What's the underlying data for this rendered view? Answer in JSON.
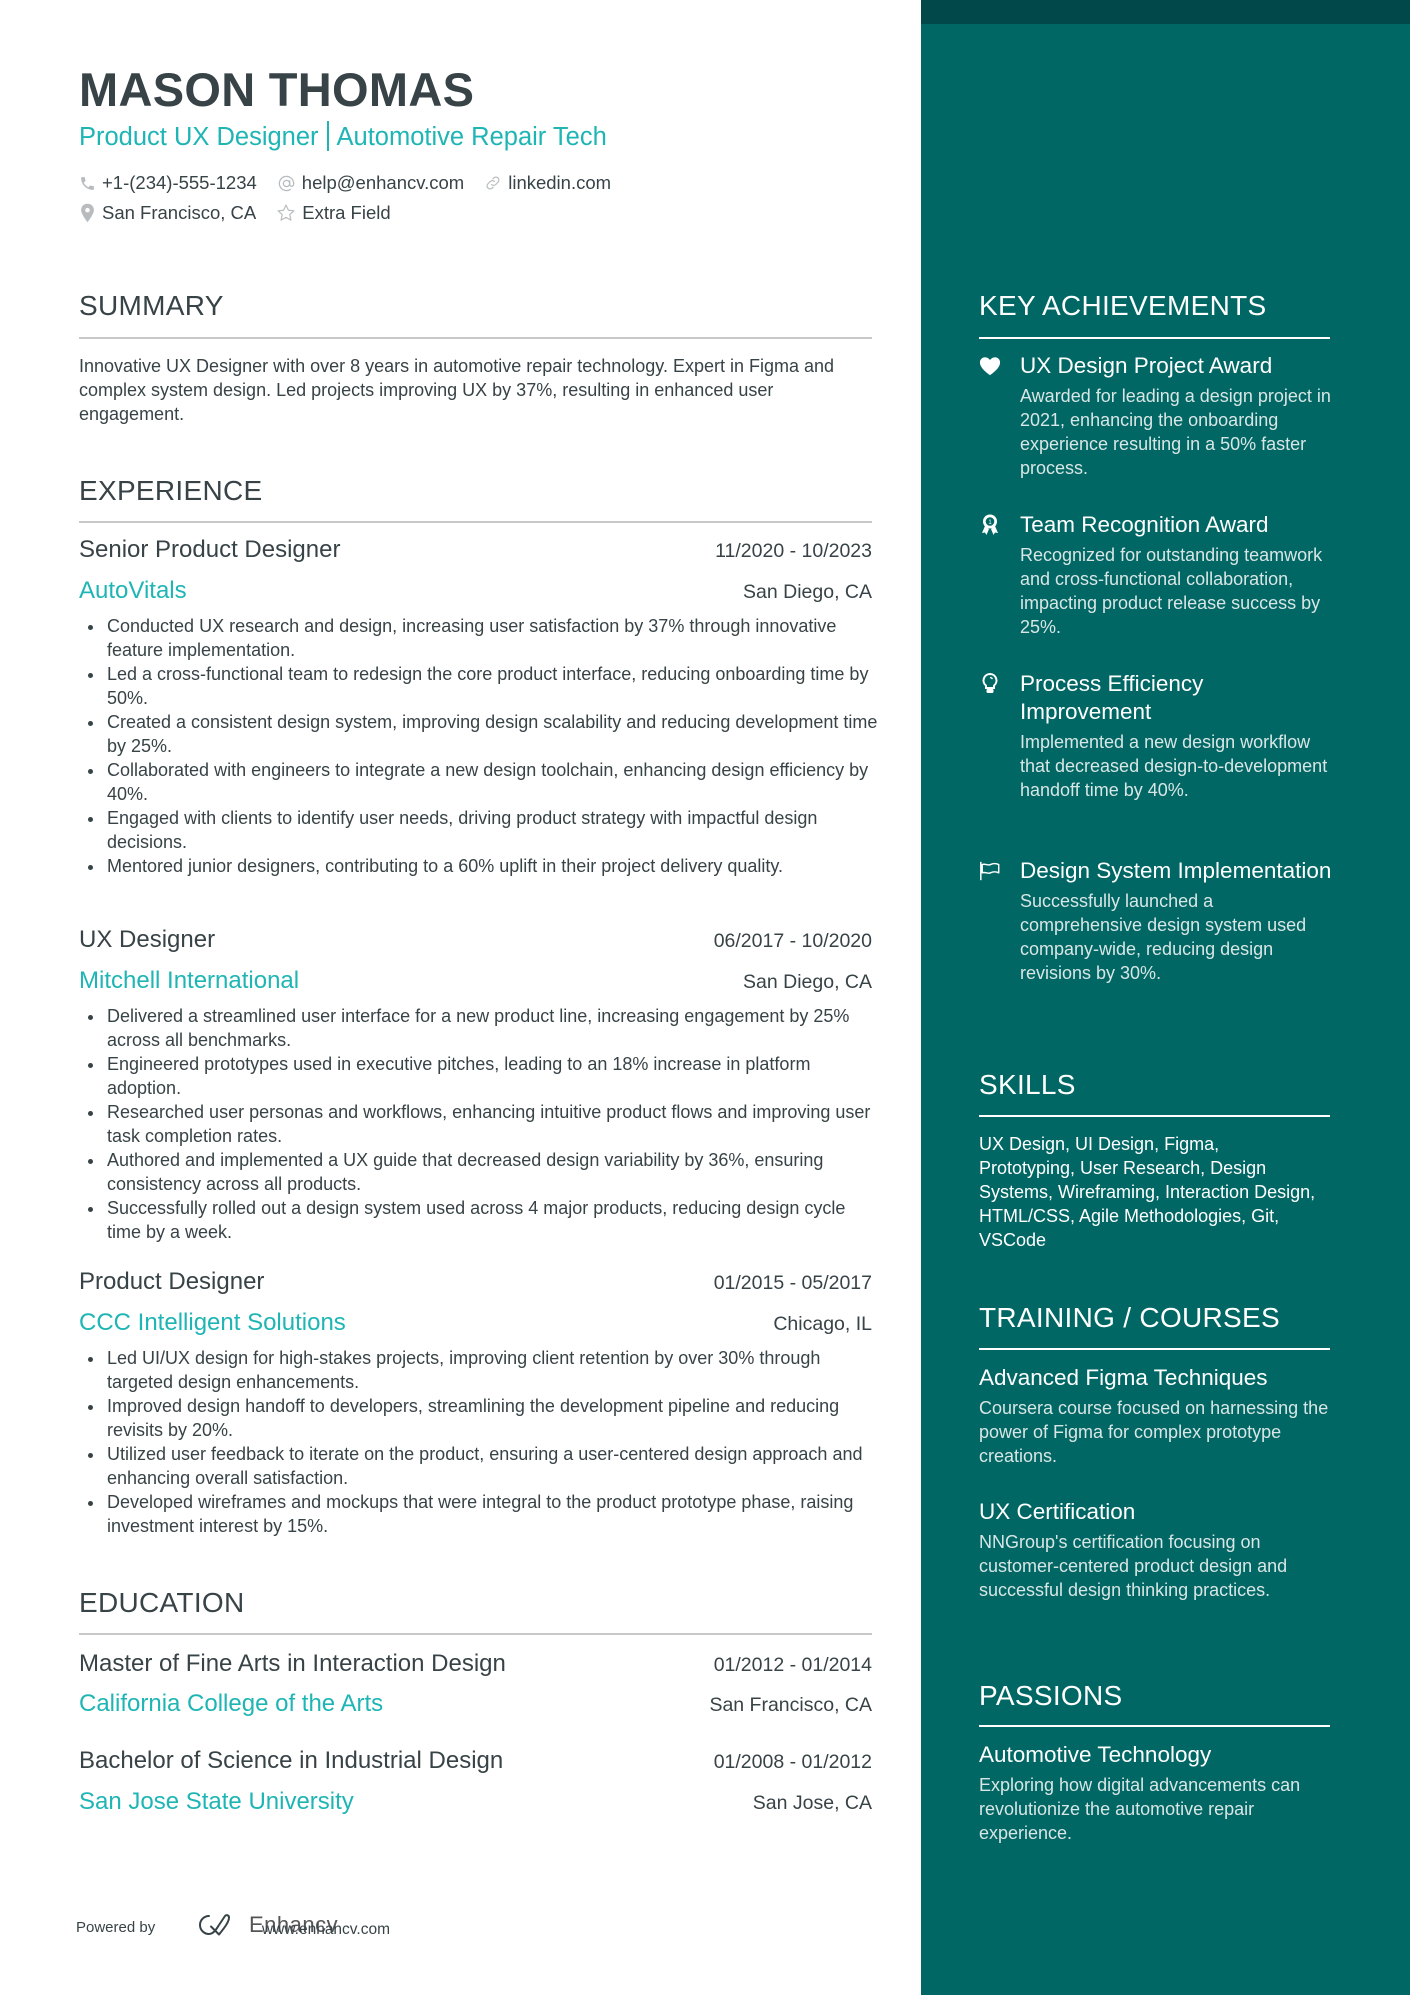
{
  "header": {
    "name": "MASON THOMAS",
    "title_left": "Product UX Designer",
    "title_right": "Automotive Repair Tech",
    "contacts": [
      {
        "icon": "phone-icon",
        "text": "+1-(234)-555-1234"
      },
      {
        "icon": "at-icon",
        "text": "help@enhancv.com"
      },
      {
        "icon": "link-icon",
        "text": "linkedin.com"
      },
      {
        "icon": "location-pin-icon",
        "text": "San Francisco, CA"
      },
      {
        "icon": "star-icon",
        "text": "Extra Field"
      }
    ]
  },
  "summary": {
    "heading": "SUMMARY",
    "text": "Innovative UX Designer with over 8 years in automotive repair technology. Expert in Figma and complex system design. Led projects improving UX by 37%, resulting in enhanced user engagement."
  },
  "experience": {
    "heading": "EXPERIENCE",
    "jobs": [
      {
        "role": "Senior Product Designer",
        "dates": "11/2020 - 10/2023",
        "company": "AutoVitals",
        "location": "San Diego, CA",
        "bullets": [
          "Conducted UX research and design, increasing user satisfaction by 37% through innovative feature implementation.",
          "Led a cross-functional team to redesign the core product interface, reducing onboarding time by 50%.",
          "Created a consistent design system, improving design scalability and reducing development time by 25%.",
          "Collaborated with engineers to integrate a new design toolchain, enhancing design efficiency by 40%.",
          "Engaged with clients to identify user needs, driving product strategy with impactful design decisions.",
          "Mentored junior designers, contributing to a 60% uplift in their project delivery quality."
        ]
      },
      {
        "role": "UX Designer",
        "dates": "06/2017 - 10/2020",
        "company": "Mitchell International",
        "location": "San Diego, CA",
        "bullets": [
          "Delivered a streamlined user interface for a new product line, increasing engagement by 25% across all benchmarks.",
          "Engineered prototypes used in executive pitches, leading to an 18% increase in platform adoption.",
          "Researched user personas and workflows, enhancing intuitive product flows and improving user task completion rates.",
          "Authored and implemented a UX guide that decreased design variability by 36%, ensuring consistency across all products.",
          "Successfully rolled out a design system used across 4 major products, reducing design cycle time by a week."
        ]
      },
      {
        "role": "Product Designer",
        "dates": "01/2015 - 05/2017",
        "company": "CCC Intelligent Solutions",
        "location": "Chicago, IL",
        "bullets": [
          "Led UI/UX design for high-stakes projects, improving client retention by over 30% through targeted design enhancements.",
          "Improved design handoff to developers, streamlining the development pipeline and reducing revisits by 20%.",
          "Utilized user feedback to iterate on the product, ensuring a user-centered design approach and enhancing overall satisfaction.",
          "Developed wireframes and mockups that were integral to the product prototype phase, raising investment interest by 15%."
        ]
      }
    ]
  },
  "education": {
    "heading": "EDUCATION",
    "items": [
      {
        "degree": "Master of Fine Arts in Interaction Design",
        "dates": "01/2012 - 01/2014",
        "school": "California College of the Arts",
        "location": "San Francisco, CA"
      },
      {
        "degree": "Bachelor of Science in Industrial Design",
        "dates": "01/2008 - 01/2012",
        "school": "San Jose State University",
        "location": "San Jose, CA"
      }
    ]
  },
  "achievements": {
    "heading": "KEY ACHIEVEMENTS",
    "items": [
      {
        "icon": "heart-icon",
        "title": "UX Design Project Award",
        "desc": "Awarded for leading a design project in 2021, enhancing the onboarding experience resulting in a 50% faster process."
      },
      {
        "icon": "award-ribbon-icon",
        "title": "Team Recognition Award",
        "desc": "Recognized for outstanding teamwork and cross-functional collaboration, impacting product release success by 25%."
      },
      {
        "icon": "lightbulb-icon",
        "title": "Process Efficiency Improvement",
        "desc": "Implemented a new design workflow that decreased design-to-development handoff time by 40%."
      },
      {
        "icon": "flag-icon",
        "title": "Design System Implementation",
        "desc": "Successfully launched a comprehensive design system used company-wide, reducing design revisions by 30%."
      }
    ]
  },
  "skills": {
    "heading": "SKILLS",
    "text": "UX Design, UI Design, Figma, Prototyping, User Research, Design Systems, Wireframing, Interaction Design, HTML/CSS, Agile Methodologies, Git, VSCode"
  },
  "training": {
    "heading": "TRAINING / COURSES",
    "items": [
      {
        "title": "Advanced Figma Techniques",
        "desc": "Coursera course focused on harnessing the power of Figma for complex prototype creations."
      },
      {
        "title": "UX Certification",
        "desc": "NNGroup's certification focusing on customer-centered product design and successful design thinking practices."
      }
    ]
  },
  "passions": {
    "heading": "PASSIONS",
    "items": [
      {
        "title": "Automotive Technology",
        "desc": "Exploring how digital advancements can revolutionize the automotive repair experience."
      }
    ]
  },
  "footer": {
    "powered_by": "Powered by",
    "brand": "Enhancv",
    "website": "www.enhancv.com"
  },
  "colors": {
    "accent": "#1fb5b5",
    "sidebar": "#006764",
    "sidebar_band": "#00484a",
    "text": "#384347"
  }
}
